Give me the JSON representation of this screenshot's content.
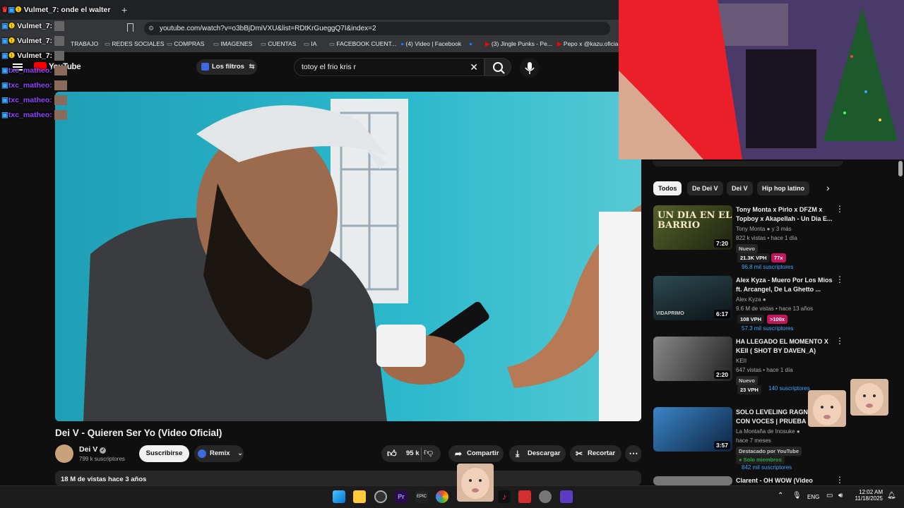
{
  "browser": {
    "url": "youtube.com/watch?v=o3bBjDmiVXU&list=RDtKrGueggQ7I&index=2",
    "tab_title": "Dei V - Quieren Ser Yo",
    "bookmarks": [
      "TRABAJO",
      "REDES SOCIALES",
      "COMPRAS",
      "IMAGENES",
      "CUENTAS",
      "IA",
      "FACEBOOK CUENT...",
      "(4) Video | Facebook",
      "(3) Jingle Punks - Pe...",
      "Pepo x @kazu.oficia..."
    ]
  },
  "youtube": {
    "logo": "YouTube",
    "filters_label": "Los filtros",
    "search_value": "totoy el frio kris r",
    "video": {
      "title": "Dei V - Quieren Ser Yo (Video Oficial)",
      "channel": "Dei V",
      "subscribers": "799 k suscriptores",
      "subscribe_label": "Suscribirse",
      "remix_label": "Remix",
      "likes": "95 k",
      "share_label": "Compartir",
      "download_label": "Descargar",
      "clip_label": "Recortar",
      "views_age": "18 M de vistas  hace 3 años"
    },
    "chips": [
      "Todos",
      "De Dei V",
      "Dei V",
      "Hip hop latino"
    ],
    "recommendations": [
      {
        "title": "Tony Monta x Pirlo x DFZM x Topboy x Akapellah - Un Dia E...",
        "channel": "Tony Monta",
        "channel_extra": "y 3 más",
        "meta": "822 k vistas • hace 1 día",
        "duration": "7:20",
        "badge": "Nuevo",
        "vph": "21.3K VPH",
        "vph_mult": "77x",
        "subs": "96.8 mil suscriptores",
        "thumb_text": "UN DIA EN EL BARRIO"
      },
      {
        "title": "Alex Kyza - Muero Por Los Mios ft. Arcangel, De La Ghetto ...",
        "channel": "Alex Kyza",
        "meta": "9.6 M de vistas • hace 13 años",
        "duration": "6:17",
        "vph": "108 VPH",
        "vph_mult": ">100x",
        "subs": "57.3 mil suscriptores",
        "thumb_text": "VIDAPRIMO"
      },
      {
        "title": "HA LLEGADO EL MOMENTO X KEII ( SHOT BY DAVEN_A)",
        "channel": "KEII",
        "meta": "647 vistas • hace 1 día",
        "duration": "2:20",
        "badge": "Nuevo",
        "vph": "23 VPH",
        "subs": "140 suscriptores"
      },
      {
        "title": "SOLO LEVELING RAGNAROK CON VOCES | PRUEBA P...",
        "channel": "La Montaña de Inosuke",
        "meta": "hace 7 meses",
        "duration": "3:57",
        "badge": "Destacado por YouTube",
        "members": "Solo miembros",
        "subs": "842 mil suscriptores"
      },
      {
        "title": "Clarent - OH WOW (Video",
        "channel": "",
        "meta": ""
      }
    ]
  },
  "chat": [
    {
      "user": "Vulmet_7:",
      "text": "onde el walter"
    },
    {
      "user": "Vulmet_7:",
      "text": ""
    },
    {
      "user": "Vulmet_7:",
      "text": ""
    },
    {
      "user": "Vulmet_7:",
      "text": ""
    },
    {
      "user": "txc_matheo:",
      "text": ""
    },
    {
      "user": "txc_matheo:",
      "text": ""
    },
    {
      "user": "txc_matheo:",
      "text": ""
    },
    {
      "user": "txc_matheo:",
      "text": ""
    }
  ],
  "taskbar": {
    "lang": "ENG",
    "time": "12:02 AM",
    "date": "11/18/2025"
  },
  "colors": {
    "vulmet": "#ffffff",
    "matheo": "#9146ff",
    "vph_badge": "#1f1f1f",
    "vph_mult": "#c2185b",
    "subs_text": "#3ea6ff",
    "members_green": "#2ba640"
  }
}
